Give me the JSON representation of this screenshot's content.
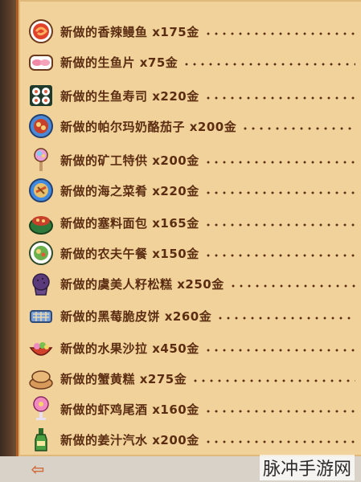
{
  "recipes": [
    {
      "text": "新做的香辣鳗鱼 x175金",
      "icon": "spicy-eel-icon"
    },
    {
      "text": "新做的生鱼片 x75金",
      "icon": "sashimi-icon"
    },
    {
      "text": "新做的生鱼寿司 x220金",
      "icon": "maki-roll-icon"
    },
    {
      "text": "新做的帕尔玛奶酪茄子 x200金",
      "icon": "eggplant-parmesan-icon"
    },
    {
      "text": "新做的矿工特供 x200金",
      "icon": "miners-treat-icon"
    },
    {
      "text": "新做的海之菜肴 x220金",
      "icon": "dish-o-the-sea-icon"
    },
    {
      "text": "新做的塞料面包 x165金",
      "icon": "stuffing-icon"
    },
    {
      "text": "新做的农夫午餐 x150金",
      "icon": "farmers-lunch-icon"
    },
    {
      "text": "新做的虞美人籽松糕 x250金",
      "icon": "poppyseed-muffin-icon"
    },
    {
      "text": "新做的黑莓脆皮饼 x260金",
      "icon": "blackberry-cobbler-icon"
    },
    {
      "text": "新做的水果沙拉 x450金",
      "icon": "fruit-salad-icon"
    },
    {
      "text": "新做的蟹黄糕 x275金",
      "icon": "crab-cakes-icon"
    },
    {
      "text": "新做的虾鸡尾酒 x160金",
      "icon": "shrimp-cocktail-icon"
    },
    {
      "text": "新做的姜汁汽水 x200金",
      "icon": "ginger-ale-icon"
    }
  ],
  "footer": {
    "back_icon": "back-arrow-icon",
    "back_glyph": "⇦"
  },
  "watermark": "脉冲手游网",
  "colors": {
    "panel": "#f1d29a",
    "text": "#5b2d12",
    "border": "#b05d24"
  }
}
